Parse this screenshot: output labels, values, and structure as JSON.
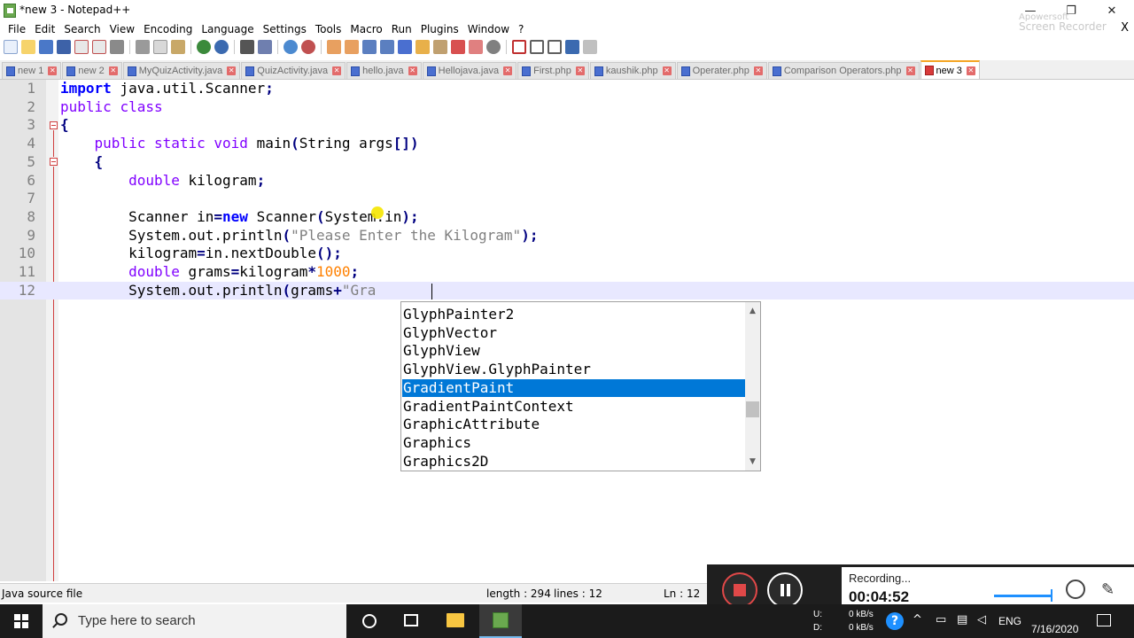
{
  "window": {
    "title": "*new 3 - Notepad++",
    "controls": {
      "minimize": "—",
      "maximize": "❐",
      "close": "✕"
    }
  },
  "watermark": {
    "line1": "Apowersoft",
    "line2": "Screen Recorder"
  },
  "menu": {
    "items": [
      "File",
      "Edit",
      "Search",
      "View",
      "Encoding",
      "Language",
      "Settings",
      "Tools",
      "Macro",
      "Run",
      "Plugins",
      "Window",
      "?"
    ],
    "close_glyph": "X"
  },
  "tabs": [
    {
      "label": "new 1",
      "active": false
    },
    {
      "label": "new 2",
      "active": false
    },
    {
      "label": "MyQuizActivity.java",
      "active": false
    },
    {
      "label": "QuizActivity.java",
      "active": false
    },
    {
      "label": "hello.java",
      "active": false
    },
    {
      "label": "Hellojava.java",
      "active": false
    },
    {
      "label": "First.php",
      "active": false
    },
    {
      "label": "kaushik.php",
      "active": false
    },
    {
      "label": "Operater.php",
      "active": false
    },
    {
      "label": "Comparison Operators.php",
      "active": false
    },
    {
      "label": "new 3",
      "active": true
    }
  ],
  "editor": {
    "line_numbers": [
      "1",
      "2",
      "3",
      "4",
      "5",
      "6",
      "7",
      "8",
      "9",
      "10",
      "11",
      "12"
    ],
    "current_line": 12
  },
  "autocomplete": {
    "items": [
      "GlyphPainter2",
      "GlyphVector",
      "GlyphView",
      "GlyphView.GlyphPainter",
      "GradientPaint",
      "GradientPaintContext",
      "GraphicAttribute",
      "Graphics",
      "Graphics2D"
    ],
    "selected": "GradientPaint",
    "scroll_up": "▲",
    "scroll_down": "▼"
  },
  "status": {
    "file_type": "Java source file",
    "length": "length : 294",
    "lines": "lines : 12",
    "ln": "Ln : 12"
  },
  "recorder": {
    "label": "Recording...",
    "time": "00:04:52"
  },
  "taskbar": {
    "search_placeholder": "Type here to search",
    "net_u_label": "U:",
    "net_d_label": "D:",
    "net_up": "0 kB/s",
    "net_down": "0 kB/s",
    "help_glyph": "?",
    "language": "ENG",
    "date": "7/16/2020"
  },
  "colors": {
    "keyword": "#0000ff",
    "type_keyword": "#8000ff",
    "string": "#808080",
    "number": "#ff8000",
    "selection": "#0078d7",
    "current_line": "#e8e8ff"
  }
}
